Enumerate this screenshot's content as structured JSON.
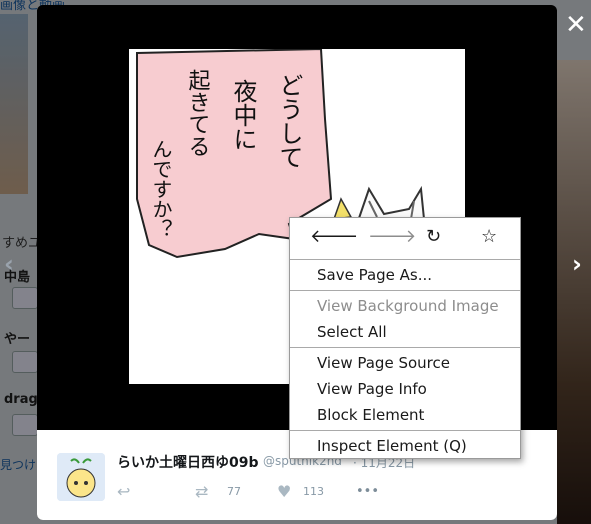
{
  "background": {
    "top_link": "画像と動画",
    "edge_title": "すめユ",
    "items": [
      "中島",
      "やー",
      "drag"
    ],
    "more_link": "見つけ"
  },
  "lightbox": {
    "close_label": "✕",
    "prev_label": "‹",
    "next_label": "›"
  },
  "image": {
    "vertical_text_col1": "どうして",
    "vertical_text_col2": "夜中に",
    "vertical_text_col3": "起きてる",
    "vertical_text_col4": "んですか？"
  },
  "tweet": {
    "author_name": "らいか土曜日西ゆ09b",
    "handle": "@sputnik2nd",
    "time": "· 11月22日",
    "retweet_count": "77",
    "like_count": "113",
    "more_label": "•••"
  },
  "context_menu": {
    "back_icon": "arrow-left-icon",
    "forward_icon": "arrow-right-icon",
    "reload_icon": "reload-icon",
    "bookmark_icon": "star-icon",
    "save_page_as": "Save Page As...",
    "view_background_image": "View Background Image",
    "select_all": "Select All",
    "view_page_source": "View Page Source",
    "view_page_info": "View Page Info",
    "block_element": "Block Element",
    "inspect_element": "Inspect Element (Q)"
  }
}
